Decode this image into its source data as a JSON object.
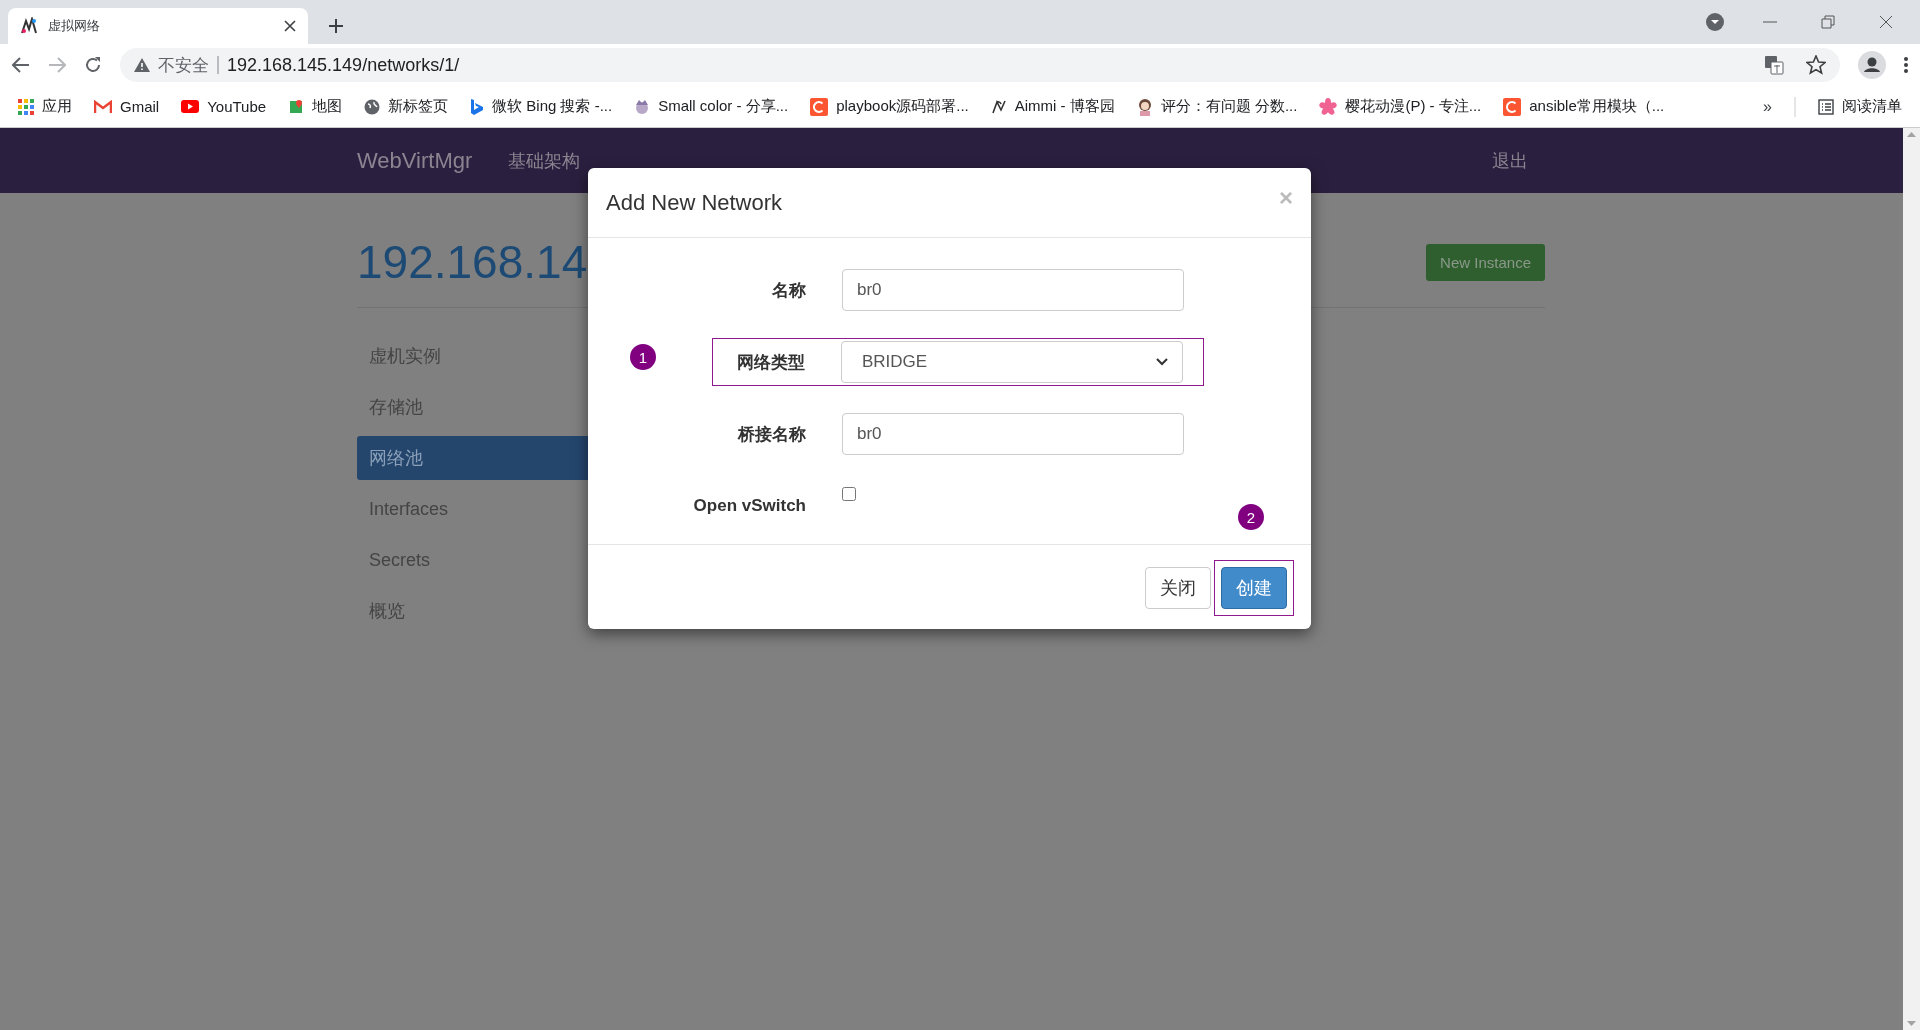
{
  "browser": {
    "tabs": [
      {
        "title": "虚拟网络",
        "selected": true
      }
    ],
    "address": {
      "security": "不安全",
      "url": "192.168.145.149/networks/1/"
    },
    "bookmarks": [
      {
        "label": "应用"
      },
      {
        "label": "Gmail"
      },
      {
        "label": "YouTube"
      },
      {
        "label": "地图"
      },
      {
        "label": "新标签页"
      },
      {
        "label": "微软 Bing 搜索 -..."
      },
      {
        "label": "Small color - 分享..."
      },
      {
        "label": "playbook源码部署..."
      },
      {
        "label": "Aimmi - 博客园"
      },
      {
        "label": "评分：有问题 分数..."
      },
      {
        "label": "樱花动漫(P) - 专注..."
      },
      {
        "label": "ansible常用模块（..."
      }
    ],
    "bookmarks_overflow": "»",
    "reading_list": "阅读清单"
  },
  "app": {
    "brand": "WebVirtMgr",
    "nav_items": [
      "基础架构"
    ],
    "logout": "退出",
    "page_title": "192.168.14",
    "new_instance": "New Instance",
    "sidebar": [
      {
        "label": "虚机实例",
        "selected": false
      },
      {
        "label": "存储池",
        "selected": false
      },
      {
        "label": "网络池",
        "selected": true
      },
      {
        "label": "Interfaces",
        "selected": false
      },
      {
        "label": "Secrets",
        "selected": false
      },
      {
        "label": "概览",
        "selected": false
      }
    ]
  },
  "modal": {
    "title": "Add New Network",
    "close": "×",
    "fields": [
      {
        "kind": "text",
        "label": "名称",
        "value": "br0",
        "highlighted": false
      },
      {
        "kind": "select",
        "label": "网络类型",
        "value": "BRIDGE",
        "highlighted": true,
        "annotation": "1"
      },
      {
        "kind": "text",
        "label": "桥接名称",
        "value": "br0",
        "highlighted": false
      },
      {
        "kind": "checkbox",
        "label": "Open vSwitch",
        "checked": false,
        "highlighted": false
      }
    ],
    "buttons": [
      {
        "label": "关闭",
        "kind": "default",
        "highlighted": false
      },
      {
        "label": "创建",
        "kind": "primary",
        "highlighted": true,
        "annotation": "2"
      }
    ]
  }
}
